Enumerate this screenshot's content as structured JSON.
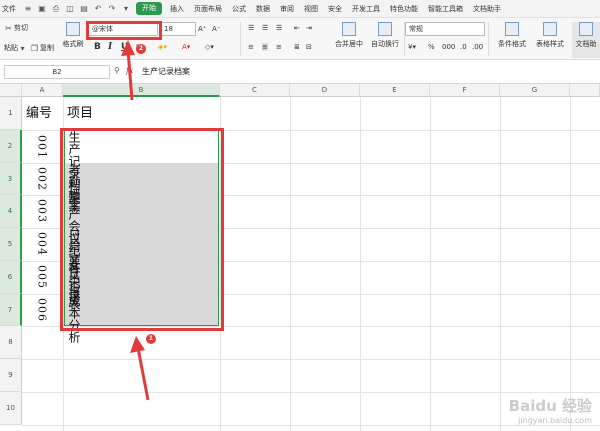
{
  "ribbon_tabs": {
    "file": "文件",
    "start": "开始",
    "items": [
      "插入",
      "页面布局",
      "公式",
      "数据",
      "审阅",
      "视图",
      "安全",
      "开发工具",
      "特色功能",
      "智能工具箱",
      "文档助手"
    ]
  },
  "ribbon": {
    "cut": "剪切",
    "copy": "复制",
    "paste": "粘贴",
    "format_painter": "格式刷",
    "font_name": "@宋体",
    "font_size": "18",
    "bold": "B",
    "italic": "I",
    "underline": "U",
    "merge_center": "合并居中",
    "wrap_text": "自动换行",
    "number_format": "常规",
    "conditional_format": "条件格式",
    "table_style": "表格样式",
    "doc_helper": "文档助"
  },
  "formula_bar": {
    "name_box": "B2",
    "fx": "fx",
    "content": "生产记录档案"
  },
  "grid": {
    "columns": [
      "A",
      "B",
      "C",
      "D",
      "E",
      "F",
      "G"
    ],
    "rows": [
      "1",
      "2",
      "3",
      "4",
      "5",
      "6",
      "7",
      "8",
      "9",
      "10"
    ],
    "header_a": "编号",
    "header_b": "项目",
    "records": [
      {
        "id": "001",
        "item": "生产记录档案"
      },
      {
        "id": "002",
        "item": "考勤档案"
      },
      {
        "id": "003",
        "item": "生产会议纪要"
      },
      {
        "id": "004",
        "item": "日常文件记录"
      },
      {
        "id": "005",
        "item": "各类报表"
      },
      {
        "id": "006",
        "item": "成本分析"
      }
    ]
  },
  "annotations": {
    "badge_1": "1",
    "badge_2": "2",
    "color": "#e23b3b"
  },
  "watermark": {
    "brand": "Baidu 经验",
    "url": "jingyan.baidu.com"
  },
  "colors": {
    "accent": "#2c9a4e",
    "selection_fill": "#d9d9d9"
  }
}
